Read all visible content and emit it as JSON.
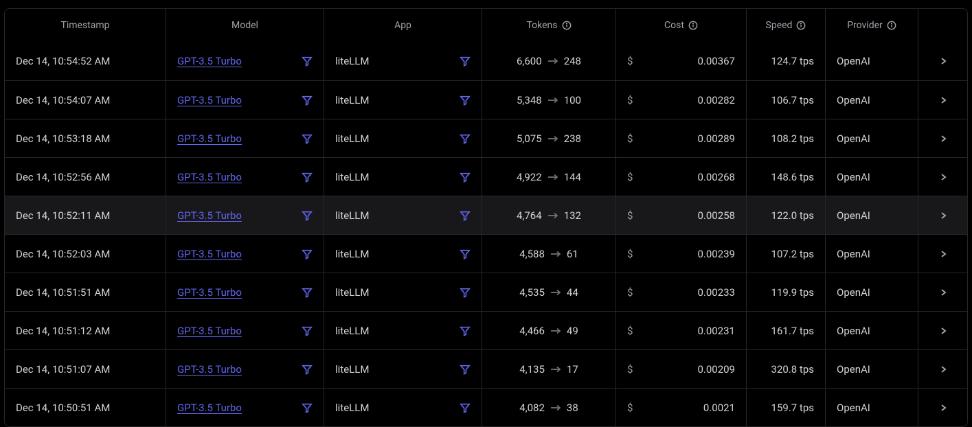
{
  "headers": {
    "timestamp": "Timestamp",
    "model": "Model",
    "app": "App",
    "tokens": "Tokens",
    "cost": "Cost",
    "speed": "Speed",
    "provider": "Provider"
  },
  "currency_symbol": "$",
  "speed_unit": "tps",
  "highlighted_row_index": 4,
  "rows": [
    {
      "timestamp": "Dec 14, 10:54:52 AM",
      "model": "GPT-3.5 Turbo",
      "app": "liteLLM",
      "tokens_in": "6,600",
      "tokens_out": "248",
      "cost": "0.00367",
      "speed": "124.7",
      "provider": "OpenAI"
    },
    {
      "timestamp": "Dec 14, 10:54:07 AM",
      "model": "GPT-3.5 Turbo",
      "app": "liteLLM",
      "tokens_in": "5,348",
      "tokens_out": "100",
      "cost": "0.00282",
      "speed": "106.7",
      "provider": "OpenAI"
    },
    {
      "timestamp": "Dec 14, 10:53:18 AM",
      "model": "GPT-3.5 Turbo",
      "app": "liteLLM",
      "tokens_in": "5,075",
      "tokens_out": "238",
      "cost": "0.00289",
      "speed": "108.2",
      "provider": "OpenAI"
    },
    {
      "timestamp": "Dec 14, 10:52:56 AM",
      "model": "GPT-3.5 Turbo",
      "app": "liteLLM",
      "tokens_in": "4,922",
      "tokens_out": "144",
      "cost": "0.00268",
      "speed": "148.6",
      "provider": "OpenAI"
    },
    {
      "timestamp": "Dec 14, 10:52:11 AM",
      "model": "GPT-3.5 Turbo",
      "app": "liteLLM",
      "tokens_in": "4,764",
      "tokens_out": "132",
      "cost": "0.00258",
      "speed": "122.0",
      "provider": "OpenAI"
    },
    {
      "timestamp": "Dec 14, 10:52:03 AM",
      "model": "GPT-3.5 Turbo",
      "app": "liteLLM",
      "tokens_in": "4,588",
      "tokens_out": "61",
      "cost": "0.00239",
      "speed": "107.2",
      "provider": "OpenAI"
    },
    {
      "timestamp": "Dec 14, 10:51:51 AM",
      "model": "GPT-3.5 Turbo",
      "app": "liteLLM",
      "tokens_in": "4,535",
      "tokens_out": "44",
      "cost": "0.00233",
      "speed": "119.9",
      "provider": "OpenAI"
    },
    {
      "timestamp": "Dec 14, 10:51:12 AM",
      "model": "GPT-3.5 Turbo",
      "app": "liteLLM",
      "tokens_in": "4,466",
      "tokens_out": "49",
      "cost": "0.00231",
      "speed": "161.7",
      "provider": "OpenAI"
    },
    {
      "timestamp": "Dec 14, 10:51:07 AM",
      "model": "GPT-3.5 Turbo",
      "app": "liteLLM",
      "tokens_in": "4,135",
      "tokens_out": "17",
      "cost": "0.00209",
      "speed": "320.8",
      "provider": "OpenAI"
    },
    {
      "timestamp": "Dec 14, 10:50:51 AM",
      "model": "GPT-3.5 Turbo",
      "app": "liteLLM",
      "tokens_in": "4,082",
      "tokens_out": "38",
      "cost": "0.0021",
      "speed": "159.7",
      "provider": "OpenAI"
    }
  ]
}
